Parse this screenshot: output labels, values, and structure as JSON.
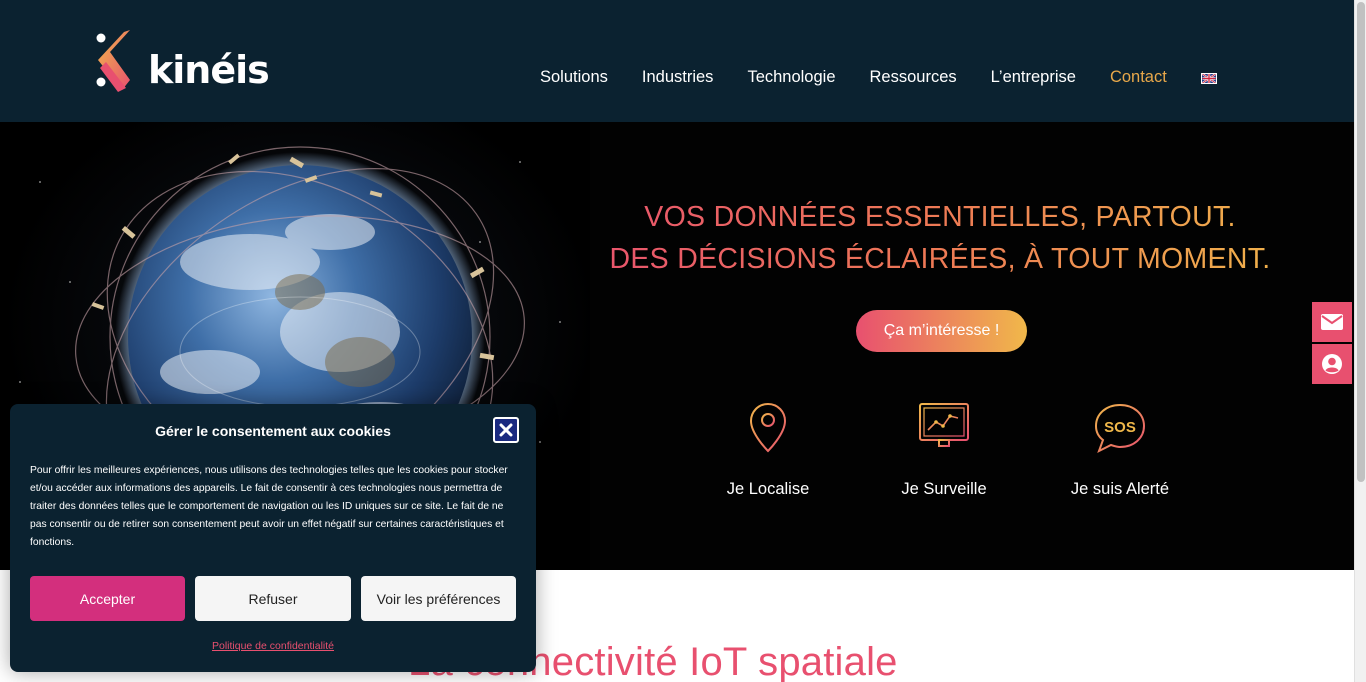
{
  "brand": {
    "logo_text": "kinéis",
    "accent": "#e8506f",
    "accent_2": "#f0b84a",
    "header_bg": "#0b2230"
  },
  "nav": {
    "items": [
      {
        "label": "Solutions"
      },
      {
        "label": "Industries"
      },
      {
        "label": "Technologie"
      },
      {
        "label": "Ressources"
      },
      {
        "label": "L’entreprise"
      },
      {
        "label": "Contact",
        "active": true
      }
    ],
    "language_icon": "uk-flag-icon"
  },
  "hero": {
    "line1": "VOS DONNÉES ESSENTIELLES, PARTOUT.",
    "line2": "DES DÉCISIONS ÉCLAIRÉES, À TOUT MOMENT.",
    "cta_label": "Ça m’intéresse !",
    "features": [
      {
        "label": "Je Localise",
        "icon": "location-pin-icon"
      },
      {
        "label": "Je Surveille",
        "icon": "monitor-chart-icon"
      },
      {
        "label": "Je suis Alerté",
        "icon": "sos-bubble-icon"
      }
    ]
  },
  "side_buttons": [
    {
      "icon": "envelope-icon"
    },
    {
      "icon": "user-circle-icon"
    }
  ],
  "section": {
    "title": "La connectivité IoT spatiale"
  },
  "cookie_modal": {
    "title": "Gérer le consentement aux cookies",
    "text": "Pour offrir les meilleures expériences, nous utilisons des technologies telles que les cookies pour stocker et/ou accéder aux informations des appareils. Le fait de consentir à ces technologies nous permettra de traiter des données telles que le comportement de navigation ou les ID uniques sur ce site. Le fait de ne pas consentir ou de retirer son consentement peut avoir un effet négatif sur certaines caractéristiques et fonctions.",
    "accept_label": "Accepter",
    "refuse_label": "Refuser",
    "prefs_label": "Voir les préférences",
    "policy_link": "Politique de confidentialité"
  }
}
